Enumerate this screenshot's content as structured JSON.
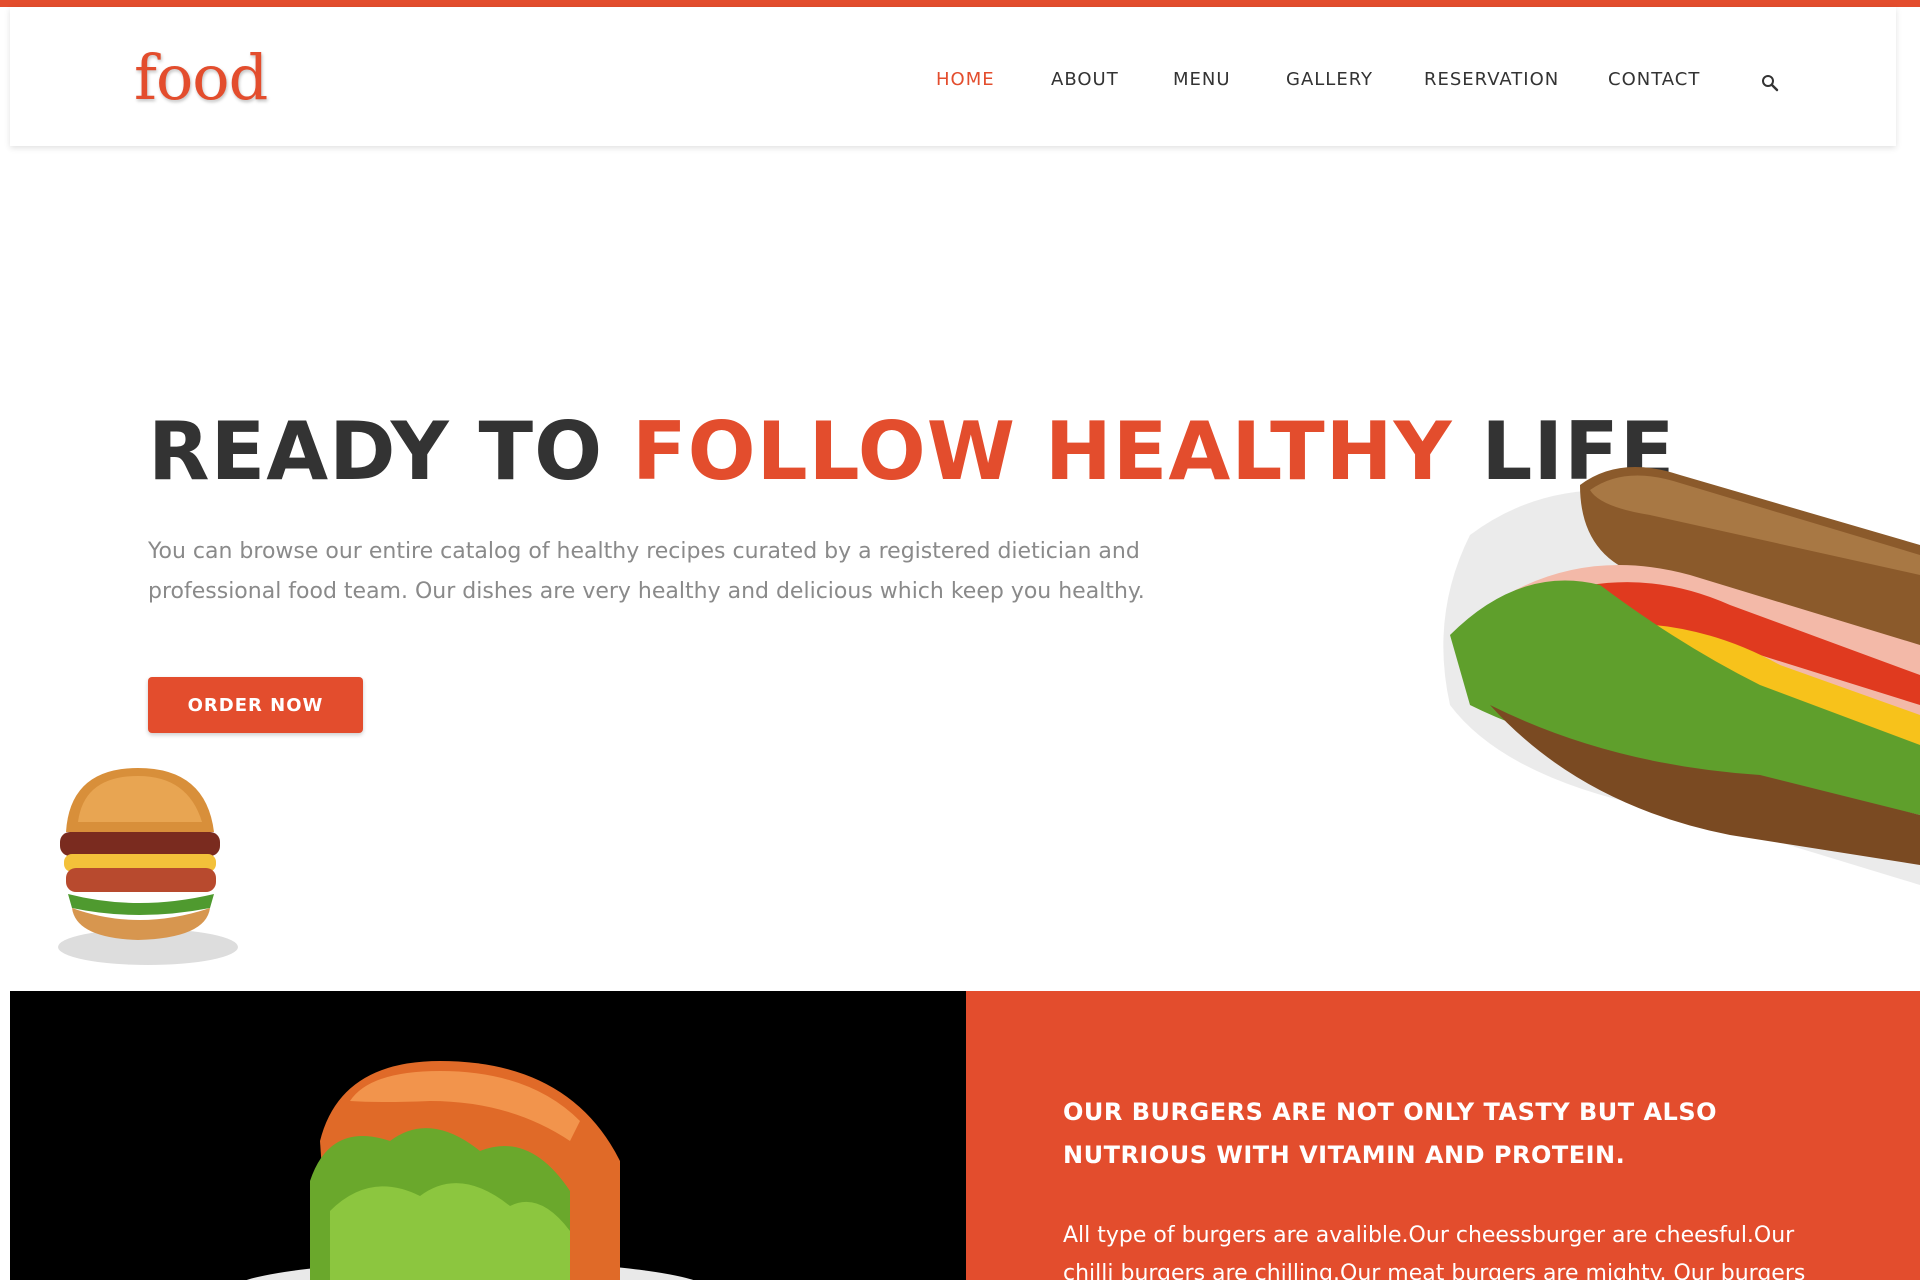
{
  "brand": {
    "logo_text": "food",
    "accent_color": "#e34d2d",
    "dark_text_color": "#333333"
  },
  "nav": {
    "items": [
      {
        "label": "HOME",
        "active": true
      },
      {
        "label": "ABOUT",
        "active": false
      },
      {
        "label": "MENU",
        "active": false
      },
      {
        "label": "GALLERY",
        "active": false
      },
      {
        "label": "RESERVATION",
        "active": false
      },
      {
        "label": "CONTACT",
        "active": false
      }
    ],
    "search_icon": "search-icon"
  },
  "hero": {
    "title_part1": "READY TO ",
    "title_accent": "FOLLOW HEALTHY",
    "title_part2": " LIFE",
    "description": "You can browse our entire catalog of healthy recipes curated by a registered dietician and professional food team. Our dishes are very healthy and delicious which keep you healthy.",
    "cta_label": "ORDER NOW"
  },
  "feature": {
    "heading": "OUR BURGERS ARE NOT ONLY TASTY BUT ALSO NUTRIOUS WITH VITAMIN AND PROTEIN.",
    "text": "All type of burgers are avalible.Our cheessburger are cheesful.Our chilli burgers are chilling.Our meat burgers are mighty. Our burgers are"
  }
}
